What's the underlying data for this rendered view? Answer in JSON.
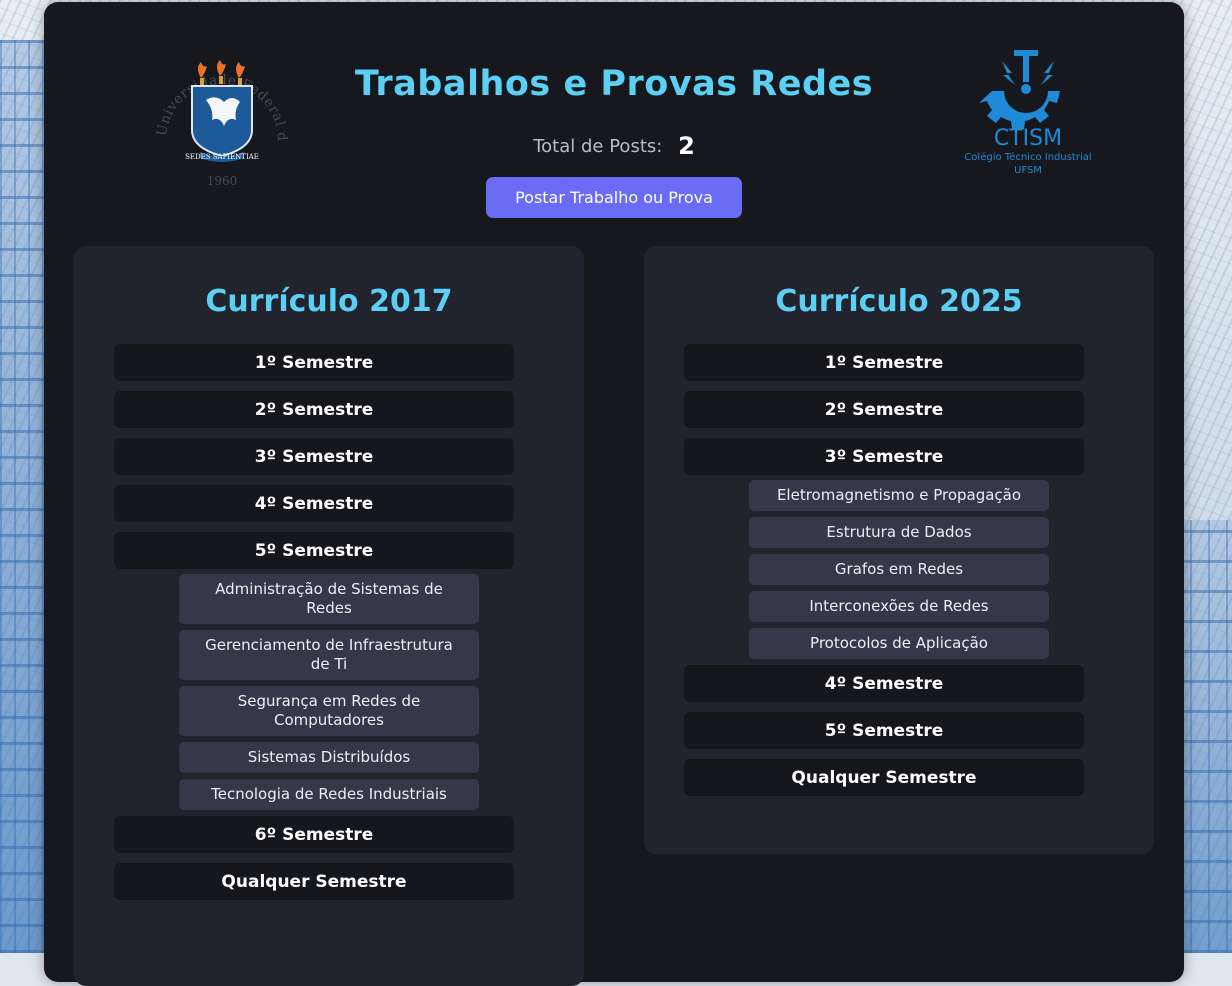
{
  "header": {
    "title": "Trabalhos e Provas Redes",
    "total_label": "Total de Posts:",
    "total_count": "2",
    "post_button": "Postar Trabalho ou Prova"
  },
  "logos": {
    "ufsm": {
      "ring_text": "Universidade Federal de Santa Maria",
      "motto": "SEDES SAPIENTIAE",
      "year": "1960"
    },
    "ctism": {
      "name": "CTISM",
      "line1": "Colégio Técnico Industrial",
      "line2": "UFSM"
    }
  },
  "colors": {
    "accent": "#5ccff5",
    "button": "#6a6cf6",
    "panel": "#17181d",
    "card": "#21232d",
    "item": "#363849"
  },
  "curricula": [
    {
      "title": "Currículo 2017",
      "semesters": [
        {
          "label": "1º Semestre"
        },
        {
          "label": "2º Semestre"
        },
        {
          "label": "3º Semestre"
        },
        {
          "label": "4º Semestre"
        },
        {
          "label": "5º Semestre",
          "subjects": [
            "Administração de Sistemas de Redes",
            "Gerenciamento de Infraestrutura de Ti",
            "Segurança em Redes de Computadores",
            "Sistemas Distribuídos",
            "Tecnologia de Redes Industriais"
          ]
        },
        {
          "label": "6º Semestre"
        },
        {
          "label": "Qualquer Semestre"
        }
      ]
    },
    {
      "title": "Currículo 2025",
      "semesters": [
        {
          "label": "1º Semestre"
        },
        {
          "label": "2º Semestre"
        },
        {
          "label": "3º Semestre",
          "subjects": [
            "Eletromagnetismo e Propagação",
            "Estrutura de Dados",
            "Grafos em Redes",
            "Interconexões de Redes",
            "Protocolos de Aplicação"
          ]
        },
        {
          "label": "4º Semestre"
        },
        {
          "label": "5º Semestre"
        },
        {
          "label": "Qualquer Semestre"
        }
      ]
    }
  ]
}
